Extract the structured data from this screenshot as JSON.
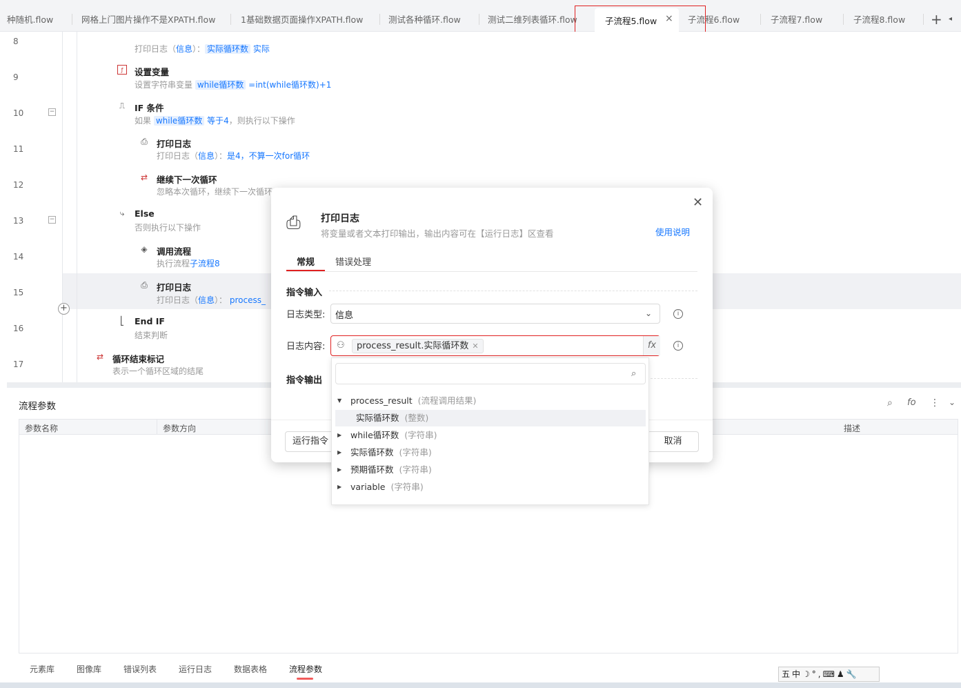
{
  "tabs": [
    {
      "label": "种随机.flow"
    },
    {
      "label": "网格上门图片操作不是XPATH.flow"
    },
    {
      "label": "1基础数据页面操作XPATH.flow"
    },
    {
      "label": "测试各种循环.flow"
    },
    {
      "label": "测试二维列表循环.flow"
    },
    {
      "label": "子流程5.flow"
    },
    {
      "label": "子流程6.flow"
    },
    {
      "label": "子流程7.flow"
    },
    {
      "label": "子流程8.flow"
    }
  ],
  "tab_close": "×",
  "tab_add": "+",
  "tab_scroll": "◂",
  "flow": {
    "line_numbers": [
      "8",
      "9",
      "10",
      "11",
      "12",
      "13",
      "14",
      "15",
      "16",
      "17"
    ],
    "row8": {
      "desc_prefix": "打印日志（",
      "desc_level": "信息",
      "desc_mid": "）：",
      "desc_var": "实际循环数",
      "desc_tail": "实际"
    },
    "row9": {
      "title": "设置变量",
      "desc_prefix": "设置字符串变量",
      "desc_var": "while循环数",
      "desc_expr": "=int(while循环数)+1"
    },
    "row10": {
      "title": "IF 条件",
      "desc_prefix": "如果",
      "desc_var": "while循环数",
      "desc_cond": "等于4",
      "desc_tail": "，则执行以下操作"
    },
    "row11": {
      "title": "打印日志",
      "desc_prefix": "打印日志（",
      "desc_level": "信息",
      "desc_mid": "）：",
      "desc_text": "是4，不算一次for循环"
    },
    "row12": {
      "title": "继续下一次循环",
      "desc": "忽略本次循环，继续下一次循环"
    },
    "row13": {
      "title": "Else",
      "desc": "否则执行以下操作"
    },
    "row14": {
      "title": "调用流程",
      "desc_prefix": "执行流程",
      "desc_link": "子流程8"
    },
    "row15": {
      "title": "打印日志",
      "desc_prefix": "打印日志（",
      "desc_level": "信息",
      "desc_mid": "）：",
      "desc_var": "process_"
    },
    "row16": {
      "title": "End IF",
      "desc": "结束判断"
    },
    "row17": {
      "title": "循环结束标记",
      "desc": "表示一个循环区域的结尾"
    }
  },
  "params": {
    "title": "流程参数",
    "columns": [
      "参数名称",
      "参数方向",
      "描述"
    ],
    "bottom_tabs": [
      "元素库",
      "图像库",
      "错误列表",
      "运行日志",
      "数据表格",
      "流程参数"
    ],
    "active_tab": "流程参数"
  },
  "modal": {
    "title": "打印日志",
    "description": "将变量或者文本打印输出，输出内容可在【运行日志】区查看",
    "help_link": "使用说明",
    "tabs": [
      "常规",
      "错误处理"
    ],
    "active_tab": "常规",
    "section_input": "指令输入",
    "section_output": "指令输出",
    "log_type_label": "日志类型:",
    "log_type_value": "信息",
    "log_content_label": "日志内容:",
    "log_content_tag": "process_result.实际循环数",
    "fx": "fx",
    "run_button": "运行指令",
    "cancel_button": "取消"
  },
  "dropdown": {
    "search_placeholder": "",
    "items": [
      {
        "name": "process_result",
        "type": "(流程调用结果)",
        "expanded": true,
        "level": 0
      },
      {
        "name": "实际循环数",
        "type": "(整数)",
        "level": 1,
        "selected": true
      },
      {
        "name": "while循环数",
        "type": "(字符串)",
        "level": 0
      },
      {
        "name": "实际循环数",
        "type": "(字符串)",
        "level": 0
      },
      {
        "name": "预期循环数",
        "type": "(字符串)",
        "level": 0
      },
      {
        "name": "variable",
        "type": "(字符串)",
        "level": 0
      }
    ]
  },
  "ime": {
    "text": "五中☽°,⌨♟🔧"
  },
  "colors": {
    "accent": "#1677ff",
    "highlight": "#e02020"
  }
}
